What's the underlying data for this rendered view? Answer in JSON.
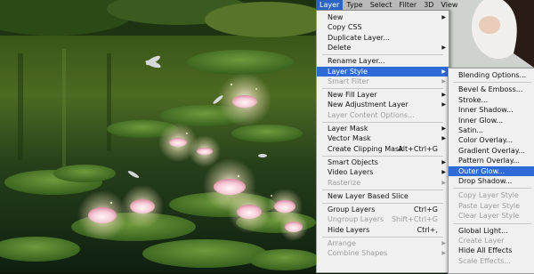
{
  "menubar": {
    "items": [
      {
        "label": "Layer",
        "active": true
      },
      {
        "label": "Type",
        "active": false
      },
      {
        "label": "Select",
        "active": false
      },
      {
        "label": "Filter",
        "active": false
      },
      {
        "label": "3D",
        "active": false
      },
      {
        "label": "View",
        "active": false
      }
    ]
  },
  "layer_menu": {
    "items": [
      {
        "label": "New",
        "submenu": true
      },
      {
        "label": "Copy CSS"
      },
      {
        "label": "Duplicate Layer..."
      },
      {
        "label": "Delete",
        "submenu": true
      },
      {
        "sep": true
      },
      {
        "label": "Rename Layer..."
      },
      {
        "label": "Layer Style",
        "submenu": true,
        "highlighted": true
      },
      {
        "label": "Smart Filter",
        "submenu": true,
        "disabled": true
      },
      {
        "sep": true
      },
      {
        "label": "New Fill Layer",
        "submenu": true
      },
      {
        "label": "New Adjustment Layer",
        "submenu": true
      },
      {
        "label": "Layer Content Options...",
        "disabled": true
      },
      {
        "sep": true
      },
      {
        "label": "Layer Mask",
        "submenu": true
      },
      {
        "label": "Vector Mask",
        "submenu": true
      },
      {
        "label": "Create Clipping Mask",
        "shortcut": "Alt+Ctrl+G"
      },
      {
        "sep": true
      },
      {
        "label": "Smart Objects",
        "submenu": true
      },
      {
        "label": "Video Layers",
        "submenu": true
      },
      {
        "label": "Rasterize",
        "submenu": true,
        "disabled": true
      },
      {
        "sep": true
      },
      {
        "label": "New Layer Based Slice"
      },
      {
        "sep": true
      },
      {
        "label": "Group Layers",
        "shortcut": "Ctrl+G"
      },
      {
        "label": "Ungroup Layers",
        "shortcut": "Shift+Ctrl+G",
        "disabled": true
      },
      {
        "label": "Hide Layers",
        "shortcut": "Ctrl+,"
      },
      {
        "sep": true
      },
      {
        "label": "Arrange",
        "submenu": true,
        "disabled": true
      },
      {
        "label": "Combine Shapes",
        "submenu": true,
        "disabled": true
      }
    ]
  },
  "layer_style_submenu": {
    "items": [
      {
        "label": "Blending Options..."
      },
      {
        "sep": true
      },
      {
        "label": "Bevel & Emboss..."
      },
      {
        "label": "Stroke..."
      },
      {
        "label": "Inner Shadow..."
      },
      {
        "label": "Inner Glow..."
      },
      {
        "label": "Satin..."
      },
      {
        "label": "Color Overlay..."
      },
      {
        "label": "Gradient Overlay..."
      },
      {
        "label": "Pattern Overlay..."
      },
      {
        "label": "Outer Glow...",
        "highlighted": true
      },
      {
        "label": "Drop Shadow..."
      },
      {
        "sep": true
      },
      {
        "label": "Copy Layer Style",
        "disabled": true
      },
      {
        "label": "Paste Layer Style",
        "disabled": true
      },
      {
        "label": "Clear Layer Style",
        "disabled": true
      },
      {
        "sep": true
      },
      {
        "label": "Global Light..."
      },
      {
        "label": "Create Layer",
        "disabled": true
      },
      {
        "label": "Hide All Effects"
      },
      {
        "label": "Scale Effects...",
        "disabled": true
      }
    ]
  },
  "colors": {
    "highlight": "#2f6bd8",
    "menu_bg": "#f0f0f0",
    "disabled_text": "#9c9c9c"
  }
}
